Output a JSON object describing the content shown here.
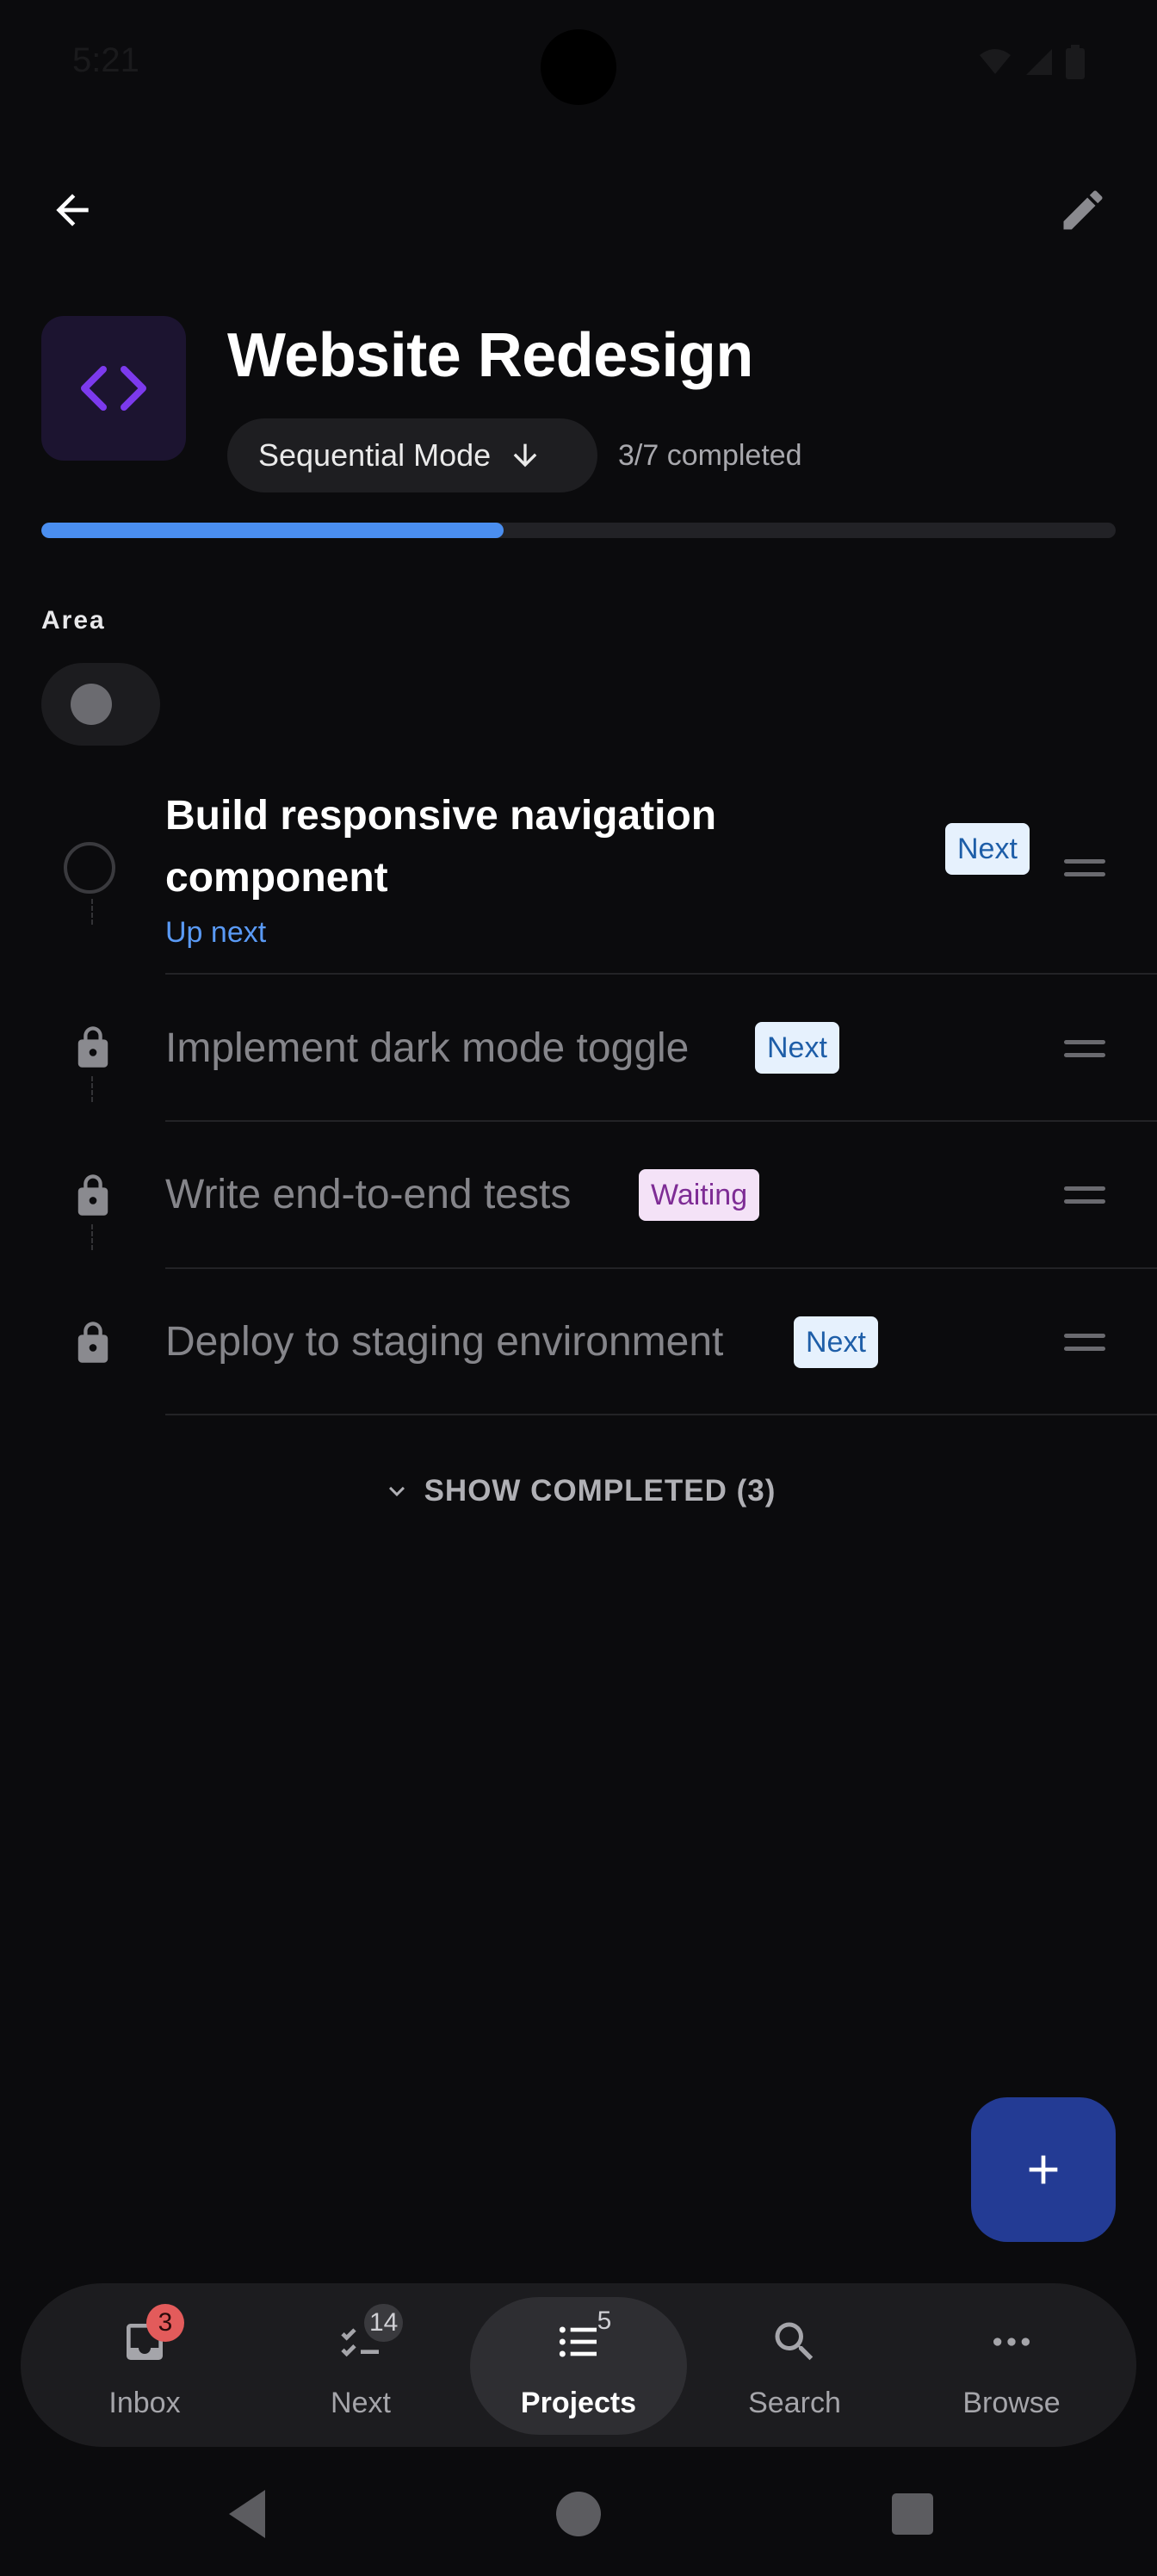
{
  "status_bar": {
    "time": "5:21"
  },
  "header": {
    "back_icon": "arrow-left-icon",
    "edit_icon": "pencil-icon",
    "project_icon": "code-brackets-icon",
    "title": "Website Redesign",
    "mode_label": "Sequential Mode",
    "completed_text": "3/7 completed",
    "progress": 0.43,
    "accent_color": "#4a8ef0"
  },
  "area": {
    "label": "Area"
  },
  "tasks": [
    {
      "title_line1": "Build responsive navigation",
      "title_line2": "component",
      "subtitle": "Up next",
      "badge": "Next",
      "state": "active"
    },
    {
      "title": "Implement dark mode toggle",
      "badge": "Next",
      "state": "locked"
    },
    {
      "title": "Write end-to-end tests",
      "badge": "Waiting",
      "state": "locked"
    },
    {
      "title": "Deploy to staging environment",
      "badge": "Next",
      "state": "locked"
    }
  ],
  "show_completed": "SHOW COMPLETED (3)",
  "fab": {
    "icon": "plus-icon"
  },
  "bottom_nav": {
    "items": [
      {
        "label": "Inbox",
        "icon": "inbox-icon",
        "count": "3"
      },
      {
        "label": "Next",
        "icon": "checklist-icon",
        "count": "14"
      },
      {
        "label": "Projects",
        "icon": "list-icon",
        "count": "5"
      },
      {
        "label": "Search",
        "icon": "search-icon"
      },
      {
        "label": "Browse",
        "icon": "more-horizontal-icon"
      }
    ],
    "active": "Projects"
  }
}
